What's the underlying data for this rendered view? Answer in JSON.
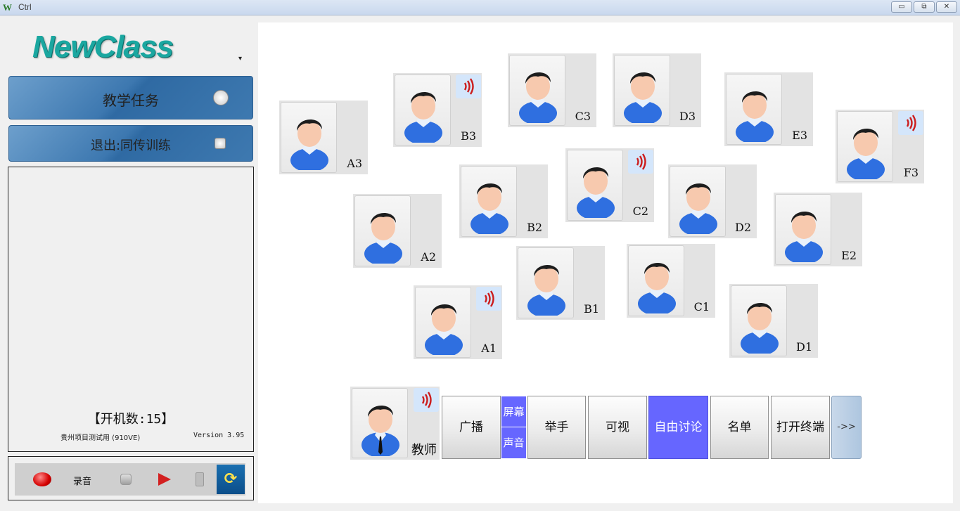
{
  "window": {
    "title": "Ctrl",
    "app_icon": "W"
  },
  "window_controls": {
    "minimize": "▭",
    "restore": "⧉",
    "close": "✕"
  },
  "logo": {
    "text": "NewClass",
    "caret": "▾"
  },
  "menu": {
    "task": "教学任务",
    "exit": "退出:同传训练"
  },
  "info": {
    "count": "【开机数:15】",
    "project": "贵州项目测试用 (910VE)",
    "version": "Version 3.95"
  },
  "recorder": {
    "label": "录音"
  },
  "seats": [
    {
      "id": "A3",
      "label": "A3",
      "signal": false
    },
    {
      "id": "B3",
      "label": "B3",
      "signal": true
    },
    {
      "id": "C3",
      "label": "C3",
      "signal": false
    },
    {
      "id": "D3",
      "label": "D3",
      "signal": false
    },
    {
      "id": "E3",
      "label": "E3",
      "signal": false
    },
    {
      "id": "F3",
      "label": "F3",
      "signal": true
    },
    {
      "id": "B2",
      "label": "B2",
      "signal": false
    },
    {
      "id": "C2",
      "label": "C2",
      "signal": true
    },
    {
      "id": "D2",
      "label": "D2",
      "signal": false
    },
    {
      "id": "A2",
      "label": "A2",
      "signal": false
    },
    {
      "id": "E2",
      "label": "E2",
      "signal": false
    },
    {
      "id": "B1",
      "label": "B1",
      "signal": false
    },
    {
      "id": "C1",
      "label": "C1",
      "signal": false
    },
    {
      "id": "A1",
      "label": "A1",
      "signal": true
    },
    {
      "id": "D1",
      "label": "D1",
      "signal": false
    }
  ],
  "teacher": {
    "label": "教师",
    "signal": true
  },
  "toolbar": {
    "broadcast": "广播",
    "screen": "屏幕",
    "sound": "声音",
    "raise_hand": "举手",
    "visible": "可视",
    "free_discussion": "自由讨论",
    "roster": "名单",
    "open_terminal": "打开终端",
    "more": "->>"
  },
  "colors": {
    "active": "#6666ff",
    "accent_blue": "#3d78b0"
  }
}
